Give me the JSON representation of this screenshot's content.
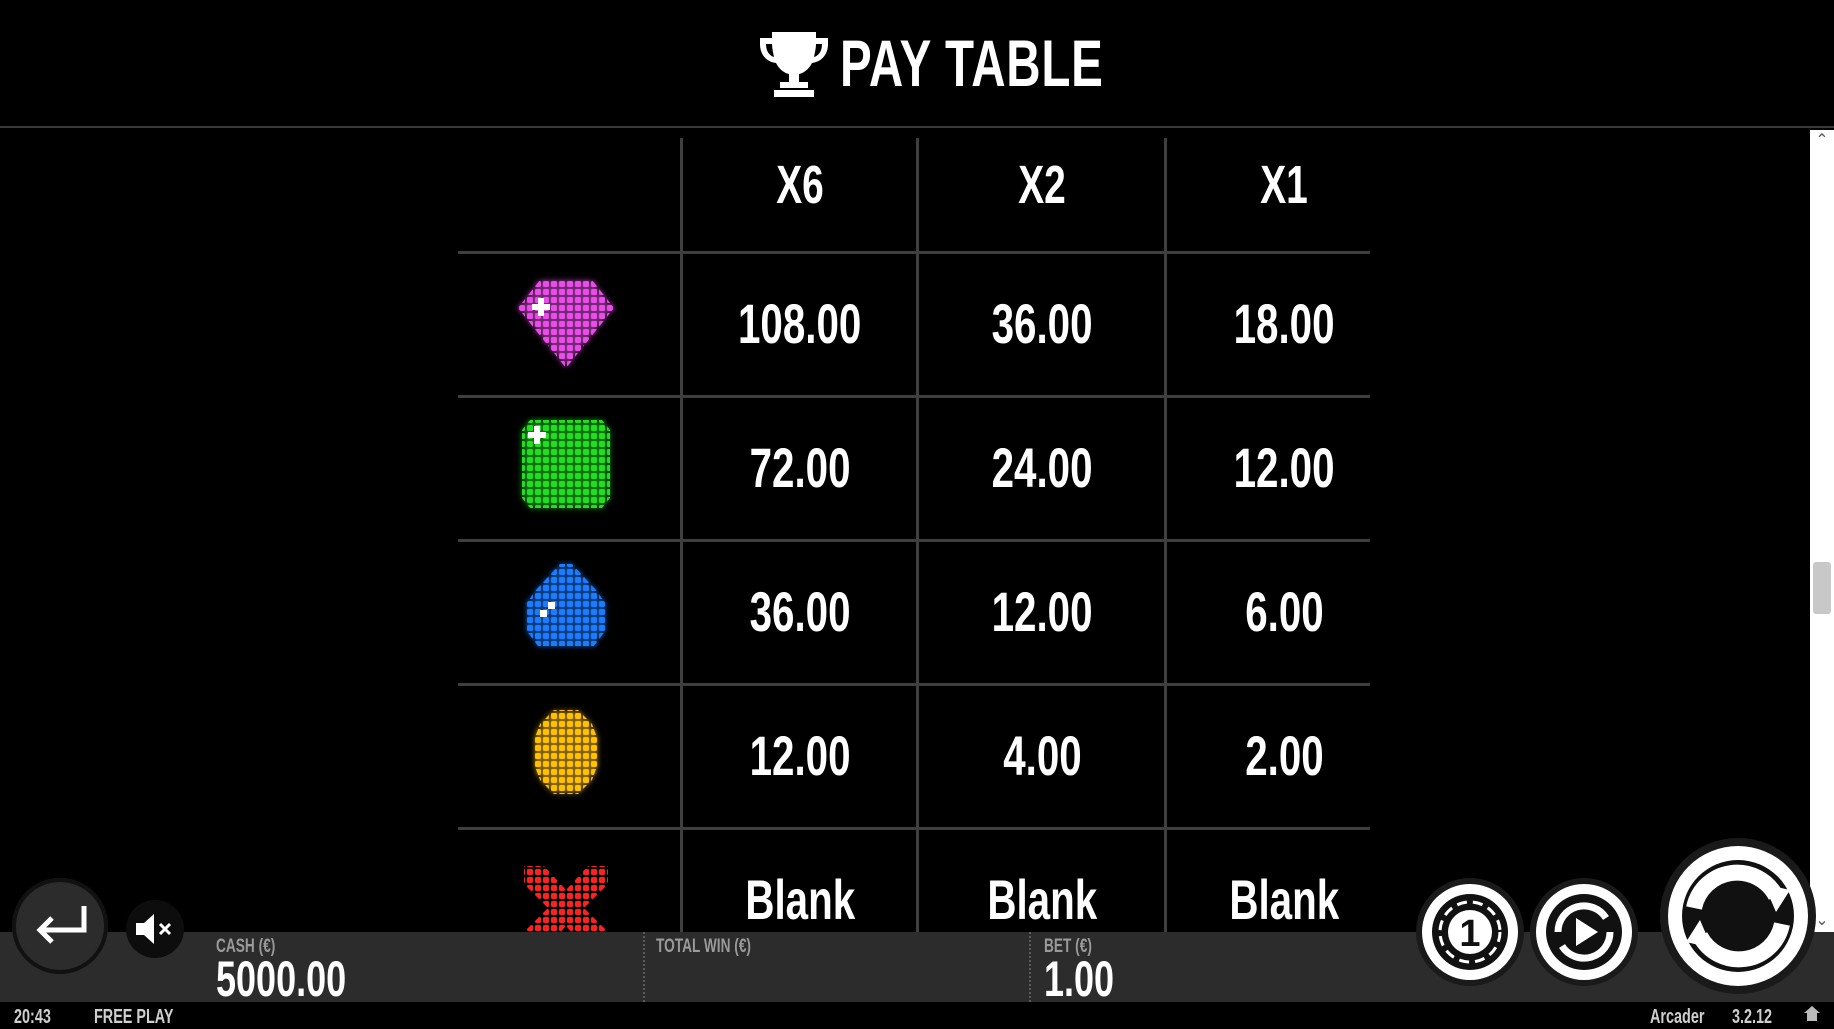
{
  "header": {
    "title": "PAY TABLE",
    "icon": "trophy-icon"
  },
  "paytable": {
    "columns": [
      "X6",
      "X2",
      "X1"
    ],
    "rows": [
      {
        "symbol": "purple-gem-icon",
        "color": "#e040e0",
        "values": [
          "108.00",
          "36.00",
          "18.00"
        ]
      },
      {
        "symbol": "green-gem-icon",
        "color": "#1ed61e",
        "values": [
          "72.00",
          "24.00",
          "12.00"
        ]
      },
      {
        "symbol": "blue-gem-icon",
        "color": "#1a78ff",
        "values": [
          "36.00",
          "12.00",
          "6.00"
        ]
      },
      {
        "symbol": "yellow-gem-icon",
        "color": "#ffc400",
        "values": [
          "12.00",
          "4.00",
          "2.00"
        ]
      },
      {
        "symbol": "red-x-icon",
        "color": "#ff1a1a",
        "values": [
          "Blank",
          "Blank",
          "Blank"
        ]
      }
    ]
  },
  "bottom_bar": {
    "cash_label": "CASH (€)",
    "cash_value": "5000.00",
    "total_win_label": "TOTAL WIN (€)",
    "total_win_value": "",
    "bet_label": "BET (€)",
    "bet_value": "1.00"
  },
  "status_bar": {
    "time": "20:43",
    "mode": "FREE PLAY",
    "game_name": "Arcader",
    "version": "3.2.12"
  },
  "controls": {
    "back": "back-arrow-icon",
    "mute": "mute-icon",
    "coin": "coin-value-icon",
    "coin_label": "1",
    "autoplay": "autoplay-icon",
    "spin": "spin-icon"
  },
  "colors": {
    "background": "#000000",
    "bar": "#2c2c2c",
    "grid": "#3f3f3f"
  }
}
